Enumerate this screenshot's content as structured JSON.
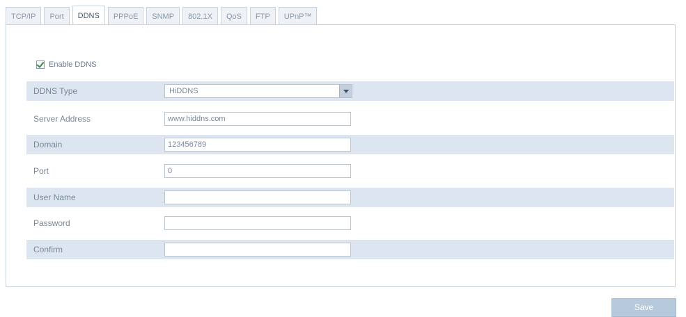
{
  "tabs": [
    {
      "label": "TCP/IP",
      "active": false
    },
    {
      "label": "Port",
      "active": false
    },
    {
      "label": "DDNS",
      "active": true
    },
    {
      "label": "PPPoE",
      "active": false
    },
    {
      "label": "SNMP",
      "active": false
    },
    {
      "label": "802.1X",
      "active": false
    },
    {
      "label": "QoS",
      "active": false
    },
    {
      "label": "FTP",
      "active": false
    },
    {
      "label": "UPnP™",
      "active": false
    }
  ],
  "enable_ddns": {
    "label": "Enable DDNS",
    "checked": true
  },
  "form": {
    "ddns_type": {
      "label": "DDNS Type",
      "value": "HiDDNS"
    },
    "server_address": {
      "label": "Server Address",
      "value": "www.hiddns.com"
    },
    "domain": {
      "label": "Domain",
      "value": "123456789"
    },
    "port": {
      "label": "Port",
      "value": "0"
    },
    "user_name": {
      "label": "User Name",
      "value": ""
    },
    "password": {
      "label": "Password",
      "value": ""
    },
    "confirm": {
      "label": "Confirm",
      "value": ""
    }
  },
  "save_label": "Save",
  "colors": {
    "row_shade": "#dde6f0",
    "border": "#c9d3de",
    "button": "#b7cadc",
    "check": "#3c8a3c"
  }
}
